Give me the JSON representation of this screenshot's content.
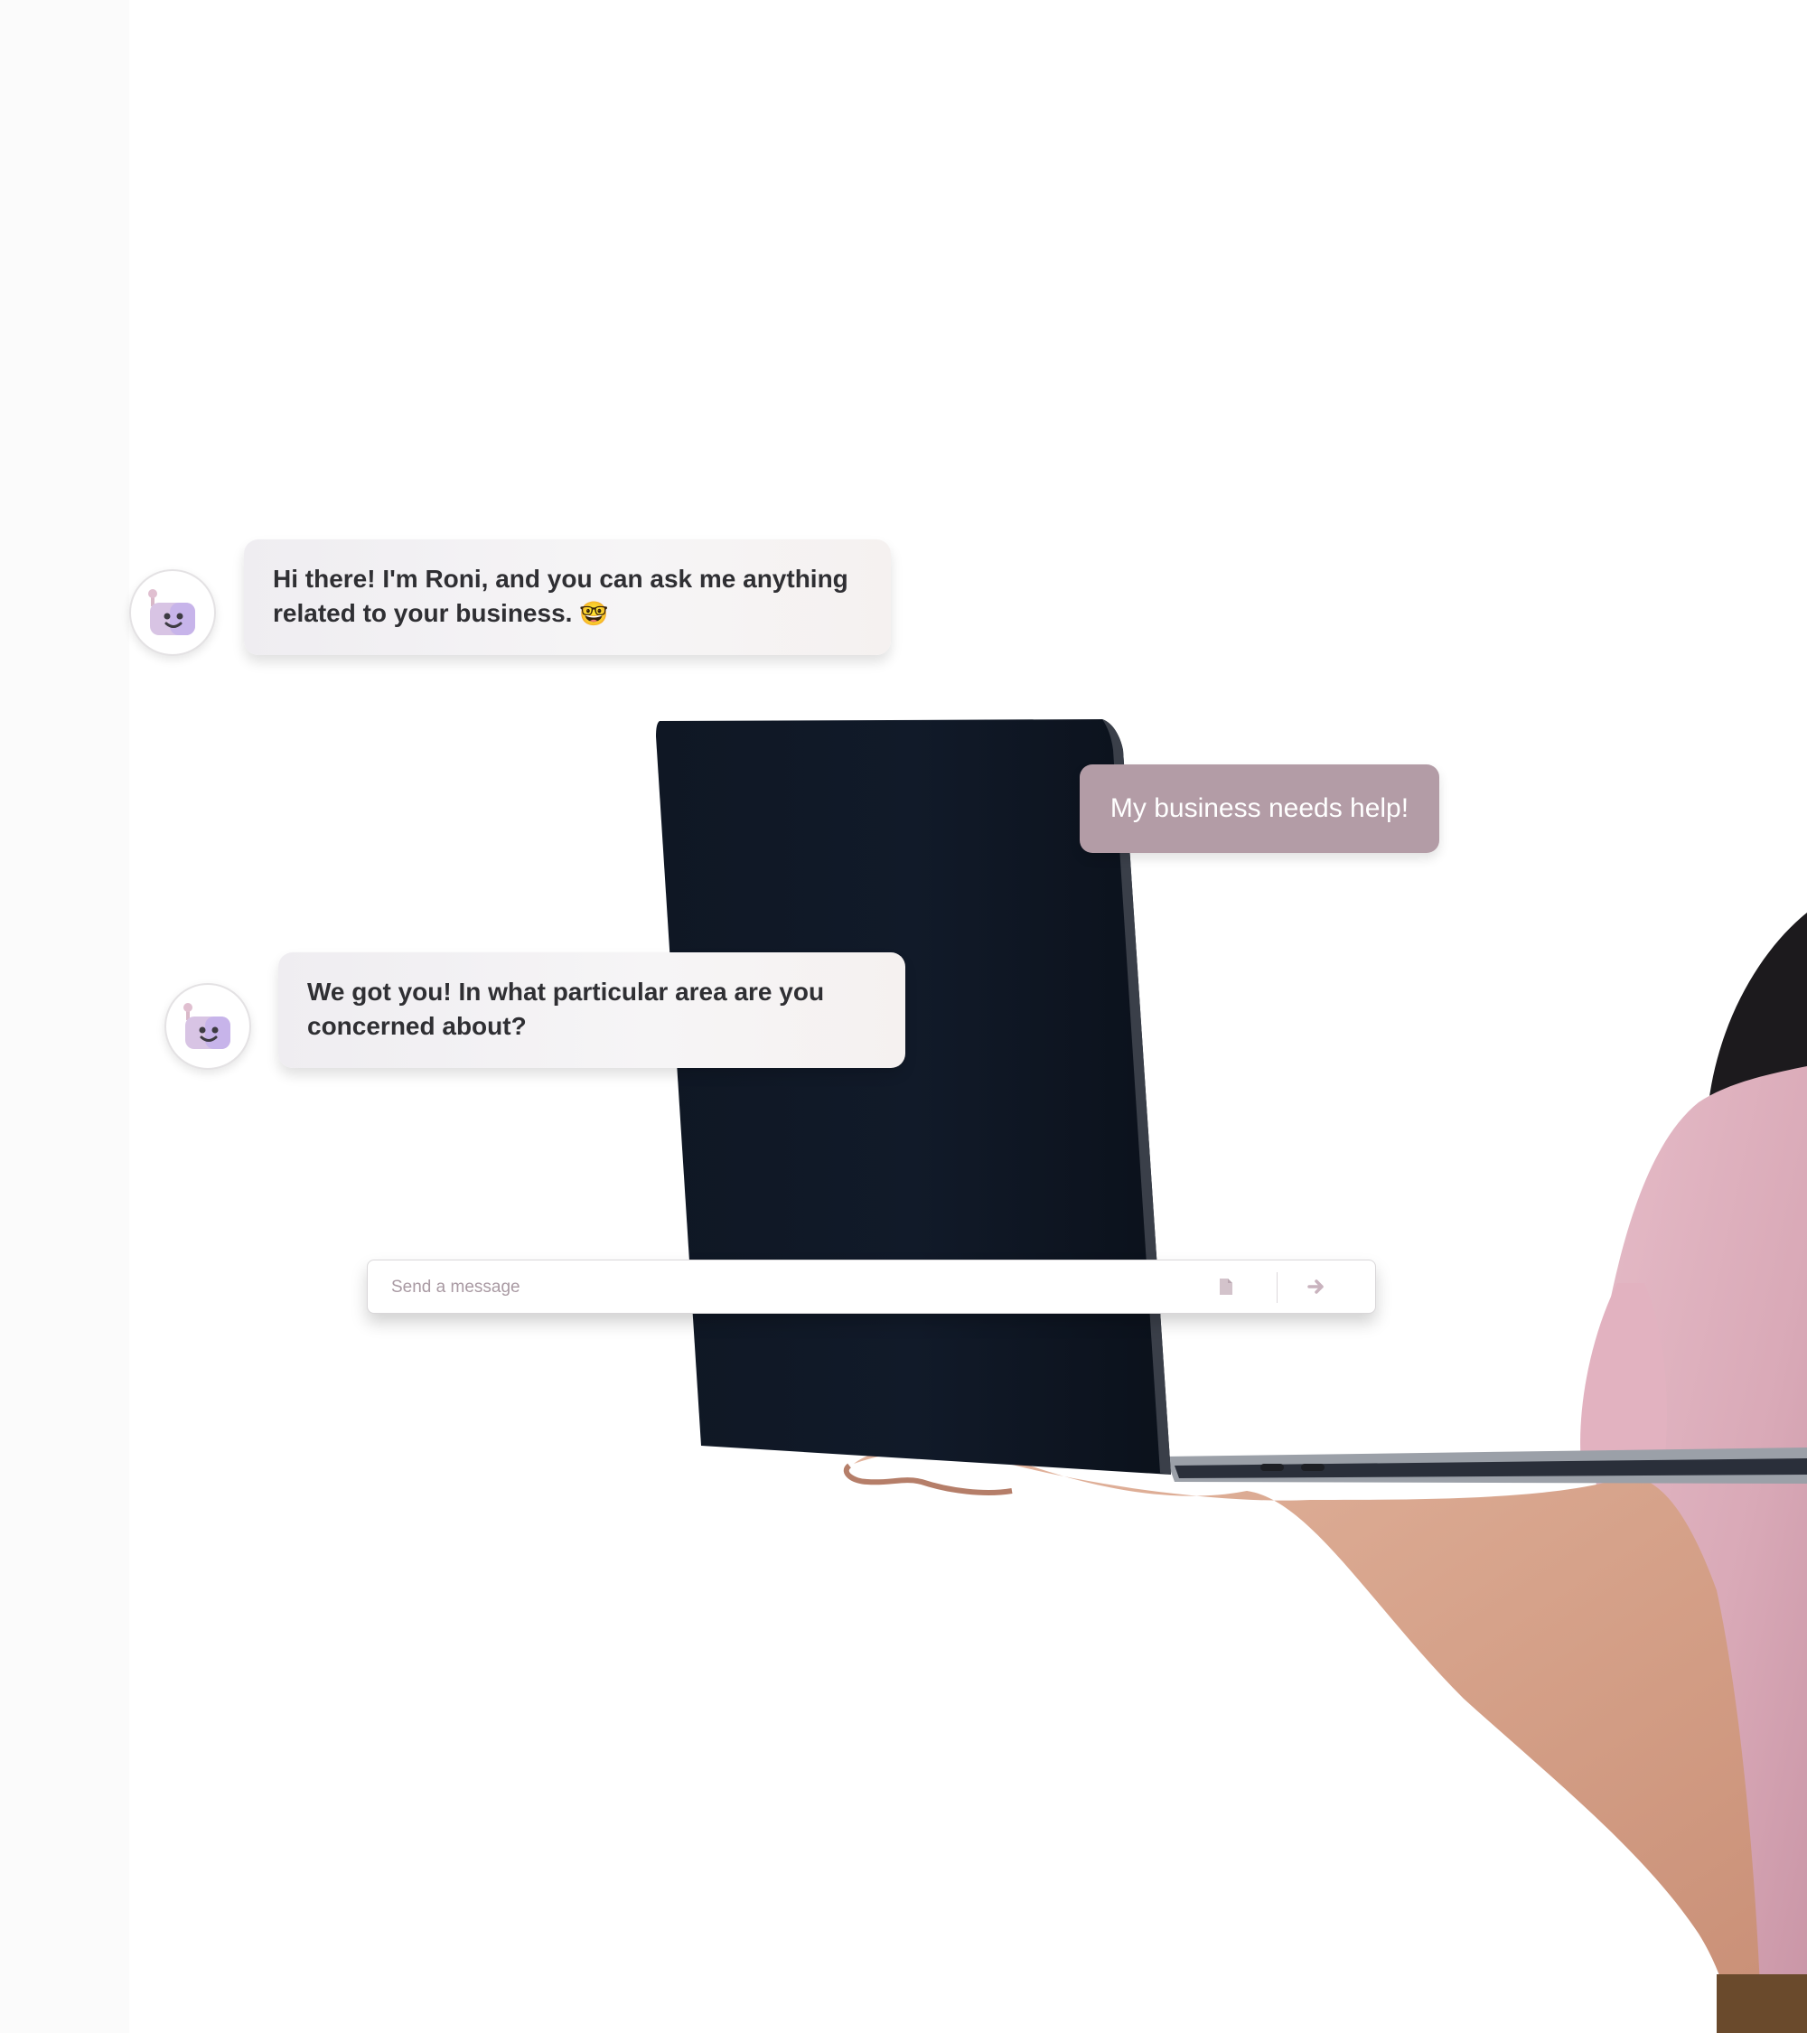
{
  "chat": {
    "messages": [
      {
        "sender": "bot",
        "text": "Hi there! I'm Roni, and you can ask me anything related to your business.",
        "emoji": "🤓"
      },
      {
        "sender": "user",
        "text": "My business needs help!"
      },
      {
        "sender": "bot",
        "text": "We got you! In what particular area are you concerned about?"
      }
    ]
  },
  "composer": {
    "placeholder": "Send a message",
    "attach_icon": "file-icon",
    "send_icon": "arrow-right-icon"
  },
  "colors": {
    "user_bubble": "#b39ca6",
    "bot_bubble": "#f3f1f4",
    "bot_text": "#2f2f33",
    "placeholder": "#a99aa3"
  }
}
